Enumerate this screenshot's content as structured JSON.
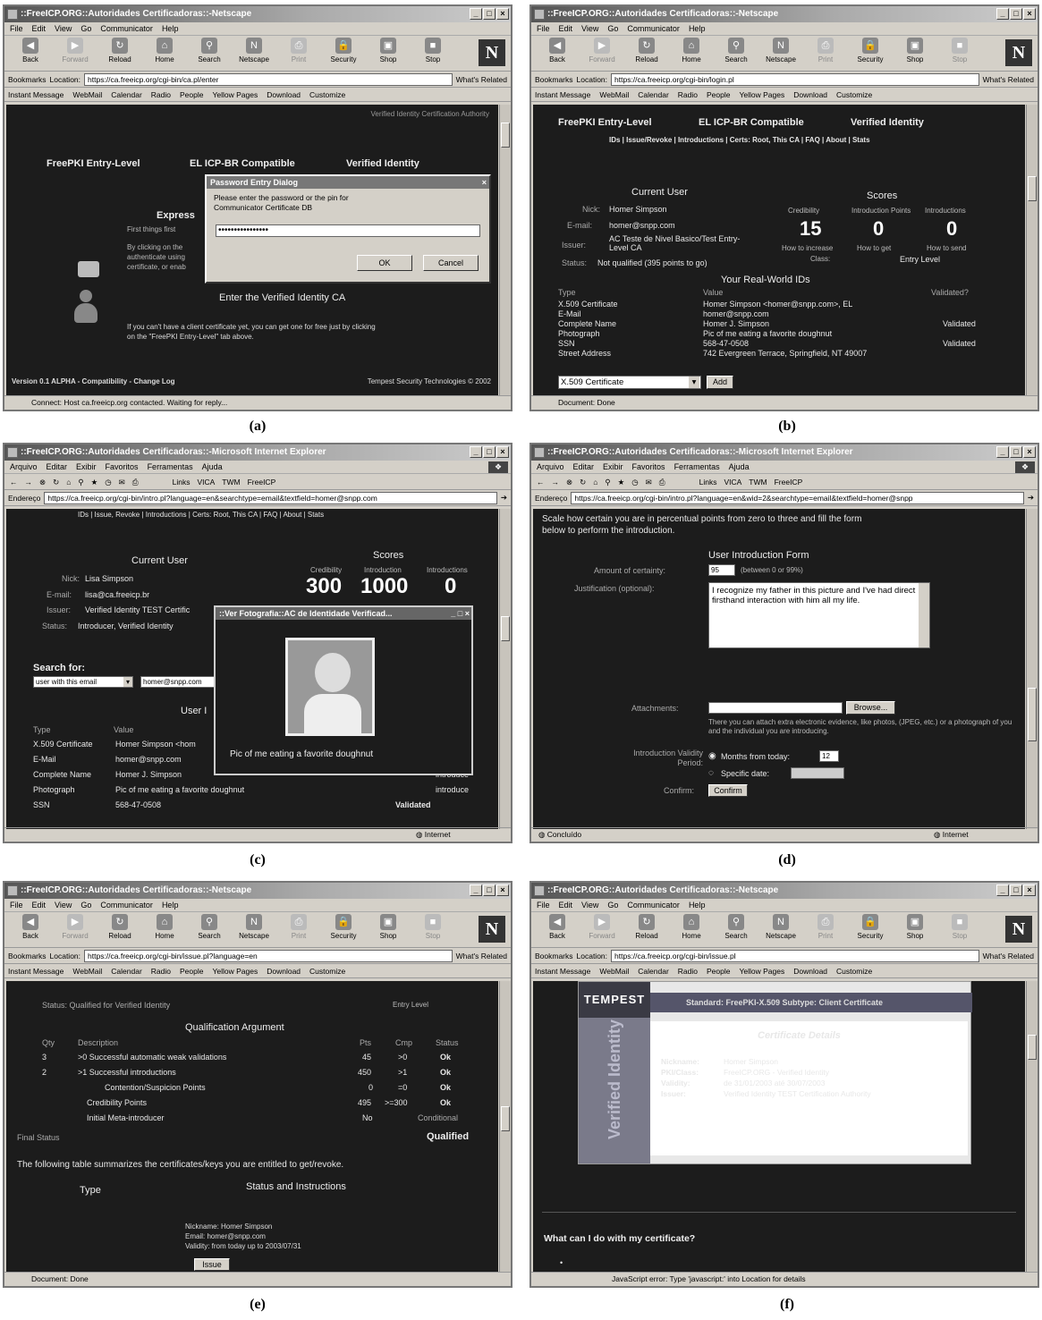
{
  "captions": [
    "(a)",
    "(b)",
    "(c)",
    "(d)",
    "(e)",
    "(f)"
  ],
  "netscape": {
    "menu": [
      "File",
      "Edit",
      "View",
      "Go",
      "Communicator",
      "Help"
    ],
    "toolbar": [
      "Back",
      "Forward",
      "Reload",
      "Home",
      "Search",
      "Netscape",
      "Print",
      "Security",
      "Shop",
      "Stop"
    ],
    "bookmarks_label": "Bookmarks",
    "location_label": "Location:",
    "whats_related": "What's Related",
    "personal": [
      "Instant Message",
      "WebMail",
      "Calendar",
      "Radio",
      "People",
      "Yellow Pages",
      "Download",
      "Customize"
    ]
  },
  "ie": {
    "menu": [
      "Arquivo",
      "Editar",
      "Exibir",
      "Favoritos",
      "Ferramentas",
      "Ajuda"
    ],
    "address_label": "Endereço",
    "links": [
      "Links",
      "VICA",
      "TWM",
      "FreeICP"
    ]
  },
  "panel_a": {
    "title": "::FreeICP.ORG::Autoridades Certificadoras::-Netscape",
    "url": "https://ca.freeicp.org/cgi-bin/ca.pl/enter",
    "header_right": "Verified Identity Certification Authority",
    "tabs": [
      "FreePKI Entry-Level",
      "EL ICP-BR Compatible",
      "Verified Identity"
    ],
    "express": "Express",
    "first_things": "First things first",
    "by_clicking": "By clicking on the",
    "authenticate": "authenticate using",
    "certificate": "certificate, or enab",
    "enter": "Enter the Verified Identity CA",
    "note1": "If you can't have a client certificate yet, you can get one for free just by clicking",
    "note2": "on the \"FreePKI Entry-Level\" tab above.",
    "footer_left": "Version 0.1 ALPHA - Compatibility - Change Log",
    "footer_right": "Tempest Security Technologies © 2002",
    "status": "Connect: Host ca.freeicp.org contacted. Waiting for reply...",
    "dialog": {
      "title": "Password Entry Dialog",
      "message": "Please enter the password or the pin for Communicator Certificate DB",
      "ok": "OK",
      "cancel": "Cancel"
    }
  },
  "panel_b": {
    "title": "::FreeICP.ORG::Autoridades Certificadoras::-Netscape",
    "url": "https://ca.freeicp.org/cgi-bin/login.pl",
    "tabs": [
      "FreePKI Entry-Level",
      "EL ICP-BR Compatible",
      "Verified Identity"
    ],
    "nav": "IDs | Issue/Revoke | Introductions | Certs: Root, This CA | FAQ | About | Stats",
    "current_user": "Current User",
    "scores": "Scores",
    "fields": [
      {
        "label": "Nick:",
        "value": "Homer Simpson"
      },
      {
        "label": "E-mail:",
        "value": "homer@snpp.com"
      },
      {
        "label": "Issuer:",
        "value": "AC Teste de Nivel Basico/Test Entry-Level CA"
      },
      {
        "label": "Status:",
        "value": "Not qualified (395 points to go)"
      }
    ],
    "score_labels": [
      "Credibility",
      "Introduction Points",
      "Introductions"
    ],
    "score_values": [
      "15",
      "0",
      "0"
    ],
    "score_subs": [
      "How to increase",
      "How to get",
      "How to send"
    ],
    "class_label": "Class:",
    "class_value": "Entry Level",
    "realworld": "Your Real-World IDs",
    "id_headers": [
      "Type",
      "Value",
      "Validated?"
    ],
    "ids": [
      {
        "type": "X.509 Certificate",
        "value": "Homer Simpson <homer@snpp.com>, EL",
        "validated": ""
      },
      {
        "type": "E-Mail",
        "value": "homer@snpp.com",
        "validated": ""
      },
      {
        "type": "Complete Name",
        "value": "Homer J. Simpson",
        "validated": "Validated"
      },
      {
        "type": "Photograph",
        "value": "Pic of me eating a favorite doughnut",
        "validated": ""
      },
      {
        "type": "SSN",
        "value": "568-47-0508",
        "validated": "Validated"
      },
      {
        "type": "Street Address",
        "value": "742 Evergreen Terrace, Springfield, NT 49007",
        "validated": ""
      }
    ],
    "select": "X.509 Certificate",
    "add": "Add",
    "status": "Document: Done"
  },
  "panel_c": {
    "title": "::FreeICP.ORG::Autoridades Certificadoras::-Microsoft Internet Explorer",
    "url": "https://ca.freeicp.org/cgi-bin/intro.pl?language=en&searchtype=email&textfield=homer@snpp.com",
    "nav": "IDs | Issue, Revoke | Introductions | Certs: Root, This CA | FAQ | About | Stats",
    "current_user": "Current User",
    "scores": "Scores",
    "fields": [
      {
        "label": "Nick:",
        "value": "Lisa Simpson"
      },
      {
        "label": "E-mail:",
        "value": "lisa@ca.freeicp.br"
      },
      {
        "label": "Issuer:",
        "value": "Verified Identity TEST Certific"
      },
      {
        "label": "Status:",
        "value": "Introducer, Verified Identity"
      }
    ],
    "score_labels": [
      "Credibility",
      "Introduction",
      "Introductions"
    ],
    "score_values": [
      "300",
      "1000",
      "0"
    ],
    "search_for": "Search for:",
    "search_type": "user with this email",
    "search_value": "homer@snpp.com",
    "user_heading": "User I",
    "id_headers": [
      "Type",
      "Value"
    ],
    "ids": [
      {
        "type": "X.509 Certificate",
        "value": "Homer Simpson <hom",
        "validated": ""
      },
      {
        "type": "E-Mail",
        "value": "homer@snpp.com",
        "validated": ""
      },
      {
        "type": "Complete Name",
        "value": "Homer J. Simpson",
        "validated": "introduce"
      },
      {
        "type": "Photograph",
        "value": "Pic of me eating a favorite doughnut",
        "validated": "introduce"
      },
      {
        "type": "SSN",
        "value": "568-47-0508",
        "validated": "Validated"
      }
    ],
    "popup_title": "::Ver Fotografia::AC de Identidade Verificad...",
    "popup_caption": "Pic of me eating a favorite doughnut",
    "status_right": "Internet"
  },
  "panel_d": {
    "title": "::FreeICP.ORG::Autoridades Certificadoras::-Microsoft Internet Explorer",
    "url": "https://ca.freeicp.org/cgi-bin/intro.pl?language=en&wid=2&searchtype=email&textfield=homer@snpp",
    "intro1": "Scale how certain you are in percentual points from zero to three and fill the form",
    "intro2": "below to perform the introduction.",
    "form_title": "User Introduction Form",
    "certainty_label": "Amount of certainty:",
    "certainty_value": "95",
    "certainty_hint": "(between 0 or 99%)",
    "justification_label": "Justification (optional):",
    "justification_text": "I recognize my father in this picture and I've had direct firsthand interaction with him all my life.",
    "attachments_label": "Attachments:",
    "browse": "Browse...",
    "attach_hint": "There you can attach extra electronic evidence, like photos, (JPEG, etc.) or a photograph of you and the individual you are introducing.",
    "validity_label": "Introduction Validity Period:",
    "months_label": "Months from today:",
    "months_value": "12",
    "specific_label": "Specific date:",
    "confirm_label": "Confirm:",
    "confirm_btn": "Confirm",
    "status_left": "Concluído",
    "status_right": "Internet"
  },
  "panel_e": {
    "title": "::FreeICP.ORG::Autoridades Certificadoras::-Netscape",
    "url": "https://ca.freeicp.org/cgi-bin/issue.pl?language=en",
    "status_line": "Status: Qualified for Verified Identity",
    "class_value": "Entry Level",
    "qual_title": "Qualification Argument",
    "qual_headers": [
      "Qty",
      "Description",
      "Pts",
      "Cmp",
      "Status"
    ],
    "qual_rows": [
      {
        "qty": "3",
        "desc": ">0 Successful automatic weak validations",
        "pts": "45",
        "cmp": ">0",
        "status": "Ok"
      },
      {
        "qty": "2",
        "desc": ">1 Successful introductions",
        "pts": "450",
        "cmp": ">1",
        "status": "Ok"
      },
      {
        "qty": "",
        "desc": "Contention/Suspicion Points",
        "pts": "0",
        "cmp": "=0",
        "status": "Ok"
      },
      {
        "qty": "",
        "desc": "Credibility Points",
        "pts": "495",
        "cmp": ">=300",
        "status": "Ok"
      },
      {
        "qty": "",
        "desc": "Initial Meta-introducer",
        "pts": "No",
        "cmp": "",
        "status": "Conditional"
      }
    ],
    "final_status_label": "Final Status",
    "final_status_value": "Qualified",
    "table_intro": "The following table summarizes the certificates/keys you are entitled to get/revoke.",
    "type_header": "Type",
    "status_header": "Status and Instructions",
    "details": [
      "Nickname: Homer Simpson",
      "Email: homer@snpp.com",
      "Validity: from today up to 2003/07/31"
    ],
    "issue_btn": "Issue",
    "status": "Document: Done"
  },
  "panel_f": {
    "title": "::FreeICP.ORG::Autoridades Certificadoras::-Netscape",
    "url": "https://ca.freeicp.org/cgi-bin/issue.pl",
    "brand": "TEMPEST",
    "side_text": "Verified Identity",
    "header_bar": "Standard: FreePKI-X.509   Subtype: Client Certificate",
    "details_title": "Certificate Details",
    "details": [
      {
        "label": "Nickname:",
        "value": "Homer Simpson"
      },
      {
        "label": "PKI/Class:",
        "value": "FreeICP.ORG - Verified Identity"
      },
      {
        "label": "Validity:",
        "value": "de 31/01/2003 até 30/07/2003"
      },
      {
        "label": "Issuer:",
        "value": "Verified Identity TEST Certification Authority"
      }
    ],
    "question": "What can I do with my certificate?",
    "status": "JavaScript error: Type 'javascript:' into Location for details"
  }
}
